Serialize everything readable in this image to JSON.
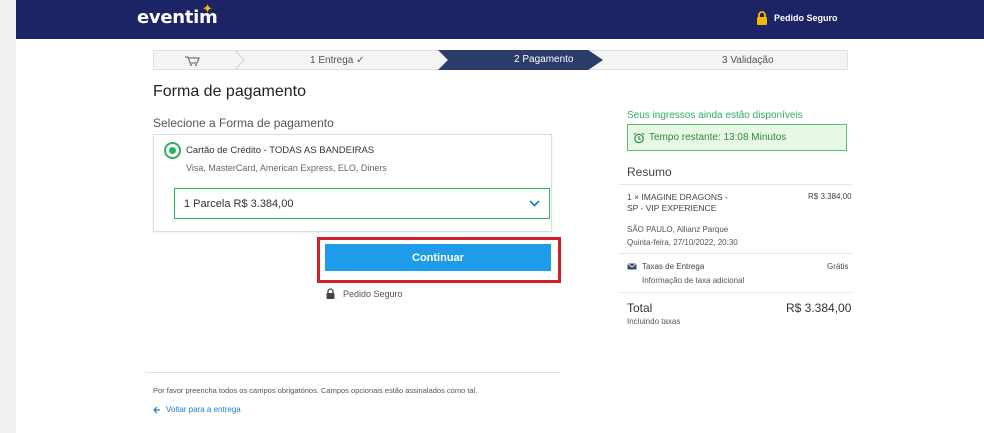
{
  "header": {
    "logo": "eventim",
    "secure_label": "Pedido Seguro"
  },
  "steps": {
    "step1": "1  Entrega",
    "step1_check": "✓",
    "step2": "2  Pagamento",
    "step3": "3  Validação"
  },
  "main": {
    "title": "Forma de pagamento",
    "subtitle": "Selecione a Forma de pagamento",
    "option_title": "Cartão de Crédito - TODAS AS BANDEIRAS",
    "option_brands": "Visa, MasterCard, American Express, ELO, Diners",
    "installment_value": "1 Parcela R$ 3.384,00",
    "continue_label": "Continuar",
    "secure_label": "Pedido Seguro",
    "required_note": "Por favor preencha todos os campos obrigatórios. Campos opcionais estão assinalados como tal.",
    "back_label": "Voltar para a entrega"
  },
  "summary": {
    "availability": "Seus ingressos ainda estão disponíveis",
    "timer": "Tempo restante: 13:08 Minutos",
    "heading": "Resumo",
    "item_line1": "1 × IMAGINE DRAGONS -",
    "item_line2": "SP - VIP EXPERIENCE",
    "item_price": "R$ 3.384,00",
    "venue": "SÃO PAULO, Allianz Parque",
    "date": "Quinta-feira, 27/10/2022, 20:30",
    "tax_label": "Taxas de Entrega",
    "tax_value": "Grátis",
    "tax_info": "Informação de taxa adicional",
    "total_label": "Total",
    "total_value": "R$ 3.384,00",
    "total_sub": "Incluindo taxas"
  },
  "colors": {
    "header": "#1d2465",
    "active_step": "#2b3c6a",
    "button": "#1e9be9",
    "highlight": "#d01f2a",
    "success": "#2fae60"
  }
}
